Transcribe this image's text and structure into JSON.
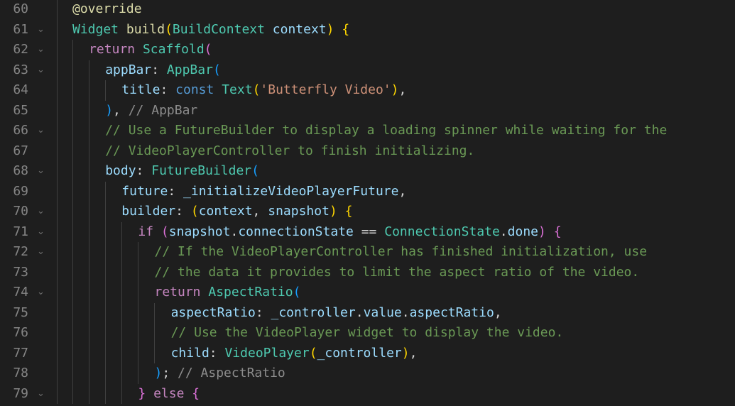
{
  "editor": {
    "language": "dart",
    "lines": [
      {
        "num": "60",
        "foldable": false,
        "tokens": [
          {
            "t": "@override",
            "c": "ann"
          }
        ]
      },
      {
        "num": "61",
        "foldable": true,
        "tokens": [
          {
            "t": "Widget",
            "c": "type"
          },
          {
            "t": " ",
            "c": "pun"
          },
          {
            "t": "build",
            "c": "fn"
          },
          {
            "t": "(",
            "c": "br1"
          },
          {
            "t": "BuildContext",
            "c": "type"
          },
          {
            "t": " ",
            "c": "pun"
          },
          {
            "t": "context",
            "c": "var"
          },
          {
            "t": ")",
            "c": "br1"
          },
          {
            "t": " ",
            "c": "pun"
          },
          {
            "t": "{",
            "c": "br1"
          }
        ]
      },
      {
        "num": "62",
        "foldable": true,
        "tokens": [
          {
            "t": "return",
            "c": "kw"
          },
          {
            "t": " ",
            "c": "pun"
          },
          {
            "t": "Scaffold",
            "c": "type"
          },
          {
            "t": "(",
            "c": "br2"
          }
        ]
      },
      {
        "num": "63",
        "foldable": true,
        "tokens": [
          {
            "t": "appBar",
            "c": "lbl"
          },
          {
            "t": ": ",
            "c": "pun"
          },
          {
            "t": "AppBar",
            "c": "type"
          },
          {
            "t": "(",
            "c": "br3"
          }
        ]
      },
      {
        "num": "64",
        "foldable": false,
        "tokens": [
          {
            "t": "title",
            "c": "lbl"
          },
          {
            "t": ": ",
            "c": "pun"
          },
          {
            "t": "const",
            "c": "kw2"
          },
          {
            "t": " ",
            "c": "pun"
          },
          {
            "t": "Text",
            "c": "type"
          },
          {
            "t": "(",
            "c": "br1"
          },
          {
            "t": "'Butterfly Video'",
            "c": "str"
          },
          {
            "t": ")",
            "c": "br1"
          },
          {
            "t": ",",
            "c": "pun"
          }
        ]
      },
      {
        "num": "65",
        "foldable": false,
        "tokens": [
          {
            "t": ")",
            "c": "br3"
          },
          {
            "t": ", ",
            "c": "pun"
          },
          {
            "t": "// AppBar",
            "c": "hint"
          }
        ]
      },
      {
        "num": "66",
        "foldable": true,
        "tokens": [
          {
            "t": "// Use a FutureBuilder to display a loading spinner while waiting for the",
            "c": "com"
          }
        ]
      },
      {
        "num": "67",
        "foldable": false,
        "tokens": [
          {
            "t": "// VideoPlayerController to finish initializing.",
            "c": "com"
          }
        ]
      },
      {
        "num": "68",
        "foldable": true,
        "tokens": [
          {
            "t": "body",
            "c": "lbl"
          },
          {
            "t": ": ",
            "c": "pun"
          },
          {
            "t": "FutureBuilder",
            "c": "type"
          },
          {
            "t": "(",
            "c": "br3"
          }
        ]
      },
      {
        "num": "69",
        "foldable": false,
        "tokens": [
          {
            "t": "future",
            "c": "lbl"
          },
          {
            "t": ": ",
            "c": "pun"
          },
          {
            "t": "_initializeVideoPlayerFuture",
            "c": "var"
          },
          {
            "t": ",",
            "c": "pun"
          }
        ]
      },
      {
        "num": "70",
        "foldable": true,
        "tokens": [
          {
            "t": "builder",
            "c": "lbl"
          },
          {
            "t": ": ",
            "c": "pun"
          },
          {
            "t": "(",
            "c": "br1"
          },
          {
            "t": "context",
            "c": "var"
          },
          {
            "t": ", ",
            "c": "pun"
          },
          {
            "t": "snapshot",
            "c": "var"
          },
          {
            "t": ")",
            "c": "br1"
          },
          {
            "t": " ",
            "c": "pun"
          },
          {
            "t": "{",
            "c": "br1"
          }
        ]
      },
      {
        "num": "71",
        "foldable": true,
        "tokens": [
          {
            "t": "if",
            "c": "kw"
          },
          {
            "t": " ",
            "c": "pun"
          },
          {
            "t": "(",
            "c": "br2"
          },
          {
            "t": "snapshot",
            "c": "var"
          },
          {
            "t": ".",
            "c": "pun"
          },
          {
            "t": "connectionState",
            "c": "var"
          },
          {
            "t": " == ",
            "c": "pun"
          },
          {
            "t": "ConnectionState",
            "c": "type"
          },
          {
            "t": ".",
            "c": "pun"
          },
          {
            "t": "done",
            "c": "var"
          },
          {
            "t": ")",
            "c": "br2"
          },
          {
            "t": " ",
            "c": "pun"
          },
          {
            "t": "{",
            "c": "br2"
          }
        ]
      },
      {
        "num": "72",
        "foldable": true,
        "tokens": [
          {
            "t": "// If the VideoPlayerController has finished initialization, use",
            "c": "com"
          }
        ]
      },
      {
        "num": "73",
        "foldable": false,
        "tokens": [
          {
            "t": "// the data it provides to limit the aspect ratio of the video.",
            "c": "com"
          }
        ]
      },
      {
        "num": "74",
        "foldable": true,
        "tokens": [
          {
            "t": "return",
            "c": "kw"
          },
          {
            "t": " ",
            "c": "pun"
          },
          {
            "t": "AspectRatio",
            "c": "type"
          },
          {
            "t": "(",
            "c": "br3"
          }
        ]
      },
      {
        "num": "75",
        "foldable": false,
        "tokens": [
          {
            "t": "aspectRatio",
            "c": "lbl"
          },
          {
            "t": ": ",
            "c": "pun"
          },
          {
            "t": "_controller",
            "c": "var"
          },
          {
            "t": ".",
            "c": "pun"
          },
          {
            "t": "value",
            "c": "var"
          },
          {
            "t": ".",
            "c": "pun"
          },
          {
            "t": "aspectRatio",
            "c": "var"
          },
          {
            "t": ",",
            "c": "pun"
          }
        ]
      },
      {
        "num": "76",
        "foldable": false,
        "tokens": [
          {
            "t": "// Use the VideoPlayer widget to display the video.",
            "c": "com"
          }
        ]
      },
      {
        "num": "77",
        "foldable": false,
        "tokens": [
          {
            "t": "child",
            "c": "lbl"
          },
          {
            "t": ": ",
            "c": "pun"
          },
          {
            "t": "VideoPlayer",
            "c": "type"
          },
          {
            "t": "(",
            "c": "br1"
          },
          {
            "t": "_controller",
            "c": "var"
          },
          {
            "t": ")",
            "c": "br1"
          },
          {
            "t": ",",
            "c": "pun"
          }
        ]
      },
      {
        "num": "78",
        "foldable": false,
        "tokens": [
          {
            "t": ")",
            "c": "br3"
          },
          {
            "t": "; ",
            "c": "pun"
          },
          {
            "t": "// AspectRatio",
            "c": "hint"
          }
        ]
      },
      {
        "num": "79",
        "foldable": true,
        "tokens": [
          {
            "t": "}",
            "c": "br2"
          },
          {
            "t": " ",
            "c": "pun"
          },
          {
            "t": "else",
            "c": "kw"
          },
          {
            "t": " ",
            "c": "pun"
          },
          {
            "t": "{",
            "c": "br2"
          }
        ]
      }
    ],
    "fold_glyph": "⌄"
  },
  "colors": {
    "background": "#1e1e1e",
    "line_number": "#858585",
    "comment": "#6a9955",
    "keyword": "#c586c0",
    "type": "#4ec9b0",
    "string": "#ce9178"
  }
}
